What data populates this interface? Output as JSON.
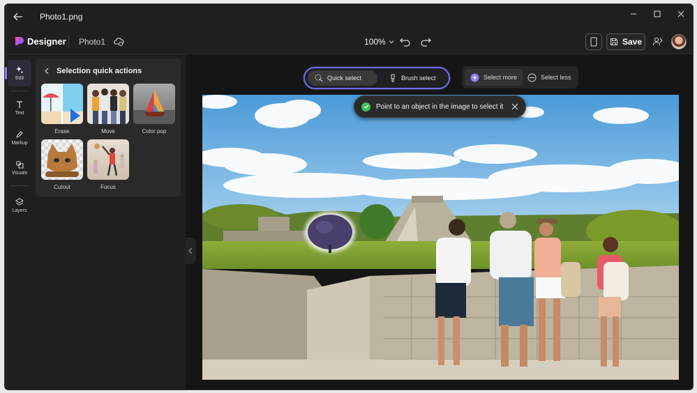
{
  "window": {
    "title": "Photo1.png"
  },
  "appbar": {
    "brand": "Designer",
    "doc_name": "Photo1",
    "zoom": "100%",
    "save_label": "Save"
  },
  "rail": {
    "items": [
      {
        "label": "Edit",
        "icon": "edit-sparkle-icon",
        "active": true
      },
      {
        "label": "Text",
        "icon": "text-icon"
      },
      {
        "label": "Markup",
        "icon": "pen-icon"
      },
      {
        "label": "Visuals",
        "icon": "shapes-icon"
      },
      {
        "label": "Layers",
        "icon": "layers-icon"
      }
    ]
  },
  "panel": {
    "title": "Selection quick actions",
    "actions": [
      {
        "label": "Erase"
      },
      {
        "label": "Move"
      },
      {
        "label": "Color pop"
      },
      {
        "label": "Cutout"
      },
      {
        "label": "Focus"
      }
    ]
  },
  "toolbar": {
    "quick_select": "Quick select",
    "brush_select": "Brush select",
    "select_more": "Select more",
    "select_less": "Select less"
  },
  "toast": {
    "message": "Point to an object in the image to select it"
  },
  "colors": {
    "accent": "#6e6af2",
    "success": "#3fbf5a",
    "background": "#1f1f1f"
  }
}
